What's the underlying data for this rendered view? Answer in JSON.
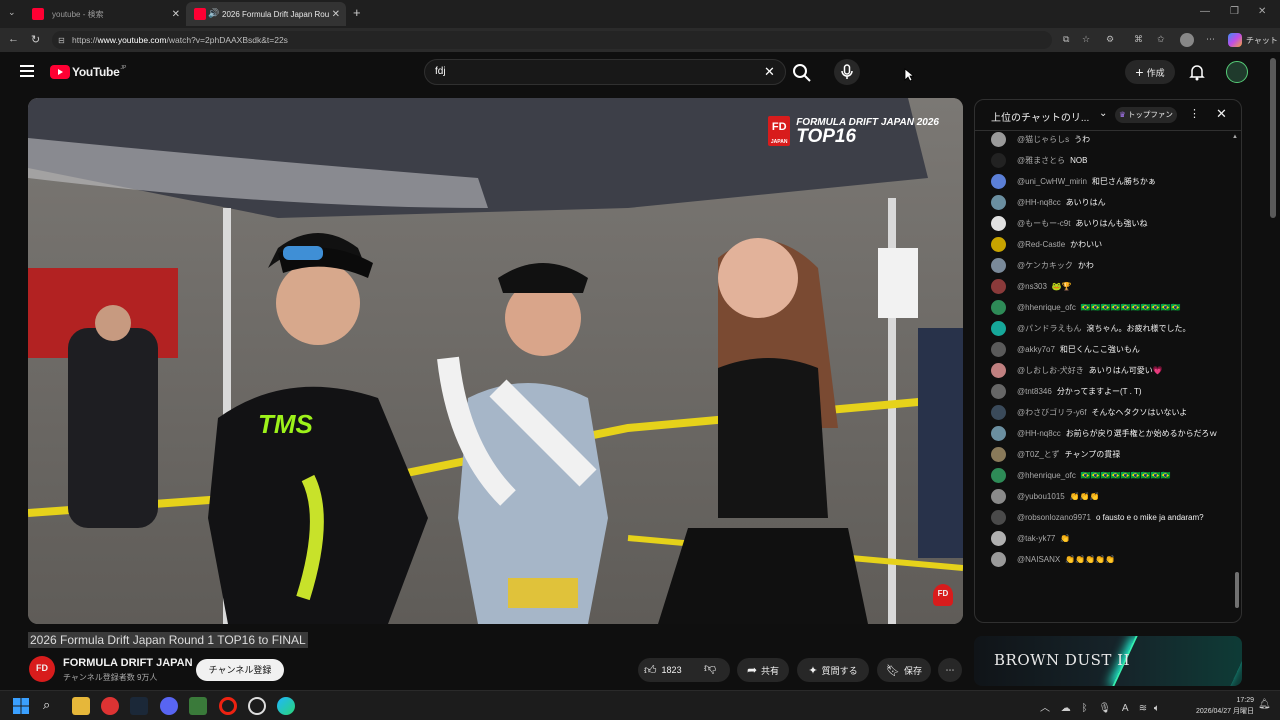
{
  "browser": {
    "tabs": [
      {
        "label": "youtube - 検索",
        "active": false
      },
      {
        "label": "2026 Formula Drift Japan Rou",
        "active": true
      }
    ],
    "url_prefix": "https://",
    "url_domain": "www.youtube.com",
    "url_path": "/watch?v=2phDAAXBsdk&t=22s",
    "copilot_label": "チャット"
  },
  "header": {
    "logo_text": "YouTube",
    "logo_region": "JP",
    "search_value": "fdj",
    "create_label": "作成"
  },
  "video": {
    "overlay_line1": "FORMULA DRIFT JAPAN 2026",
    "overlay_line2": "TOP16",
    "badge_text": "FD",
    "badge_sub": "JAPAN",
    "title": "2026 Formula Drift Japan Round 1 TOP16 to FINAL"
  },
  "channel": {
    "name": "FORMULA DRIFT JAPAN",
    "subscribers": "チャンネル登録者数 9万人",
    "subscribe_label": "チャンネル登録",
    "logo_text": "FD"
  },
  "actions": {
    "like_count": "1823",
    "share_label": "共有",
    "ask_label": "質問する",
    "save_label": "保存"
  },
  "chat": {
    "mode_label": "上位のチャットのリ...",
    "top_fan_label": "トップファン",
    "messages": [
      {
        "author": "@猫じゃらしs",
        "text": "うわ",
        "color": "#9a9a9a"
      },
      {
        "author": "@雅まさとら",
        "text": "NOB",
        "color": "#222222"
      },
      {
        "author": "@uni_CwHW_mirin",
        "text": "和巳さん勝ちかぁ",
        "color": "#5b7fd6"
      },
      {
        "author": "@HH-nq8cc",
        "text": "あいりはん",
        "color": "#6b8fa0"
      },
      {
        "author": "@もーもー-c9t",
        "text": "あいりはんも強いね",
        "color": "#e0e0e0"
      },
      {
        "author": "@Red-Castle",
        "text": "かわいい",
        "color": "#c8a400"
      },
      {
        "author": "@ケンカキック",
        "text": "かわ",
        "color": "#7a8a9a"
      },
      {
        "author": "@ns303",
        "text": "🐸🏆",
        "color": "#8a3a3a"
      },
      {
        "author": "@hhenrique_ofc",
        "text": "🇧🇷🇧🇷🇧🇷🇧🇷🇧🇷🇧🇷🇧🇷🇧🇷🇧🇷🇧🇷",
        "color": "#2e8b57"
      },
      {
        "author": "@パンドラえもん",
        "text": "滾ちゃん。お疲れ様でした。",
        "color": "#16a89a"
      },
      {
        "author": "@akky7o7",
        "text": "和巳くんここ強いもん",
        "color": "#5a5a5a"
      },
      {
        "author": "@しおしお-犬好き",
        "text": "あいりはん可愛い💗",
        "color": "#c08080"
      },
      {
        "author": "@tnt8346",
        "text": "分かってますよー(T . T)",
        "color": "#666666"
      },
      {
        "author": "@わさびゴリラ-y6f",
        "text": "そんなヘタクソはいないよ",
        "color": "#3a4a5a"
      },
      {
        "author": "@HH-nq8cc",
        "text": "お前らが戻り選手権とか始めるからだろｗ",
        "color": "#6b8fa0"
      },
      {
        "author": "@T0Z_とず",
        "text": "チャンプの貫禄",
        "color": "#8a7a5a"
      },
      {
        "author": "@hhenrique_ofc",
        "text": "🇧🇷🇧🇷🇧🇷🇧🇷🇧🇷🇧🇷🇧🇷🇧🇷🇧🇷",
        "color": "#2e8b57"
      },
      {
        "author": "@yubou1015",
        "text": "👏👏👏",
        "color": "#8a8a8a"
      },
      {
        "author": "@robsonlozano9971",
        "text": "o fausto e o mike ja andaram?",
        "color": "#4a4a4a"
      },
      {
        "author": "@tak-yk77",
        "text": "👏",
        "color": "#b0b0b0"
      },
      {
        "author": "@NAISANX",
        "text": "👏👏👏👏👏",
        "color": "#9a9a9a"
      }
    ]
  },
  "ad": {
    "brand": "BROWN DUST II"
  },
  "taskbar": {
    "time": "17:29",
    "date": "2026/04/27 月曜日"
  },
  "colors": {
    "background": "#0f0f0f",
    "youtube_red": "#ff0033",
    "fd_red": "#d81c1c"
  }
}
